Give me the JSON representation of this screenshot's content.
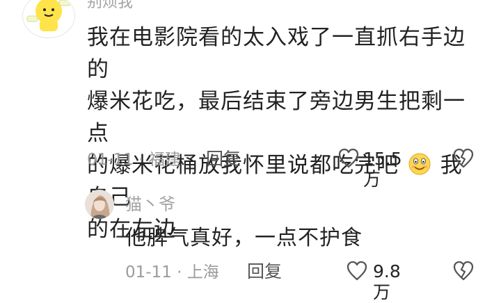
{
  "comment": {
    "username": "别烦我",
    "text_line1": "我在电影院看的太入戏了一直抓右手边的",
    "text_line2": "爆米花吃，最后结束了旁边男生把剩一点",
    "text_line3_before_emoji": "的爆米花桶放我怀里说都吃完吧",
    "text_line3_after_emoji": "我自己",
    "text_line4": "的在左边",
    "date": "01-11",
    "dot": "·",
    "location": "福建",
    "reply_label": "回复",
    "like_count": "15.5万",
    "emoji_icon": "smiling-face-emoji"
  },
  "reply_comment": {
    "username": "猫丶爷",
    "text": "他脾气真好，一点不护食",
    "date": "01-11",
    "dot": "·",
    "location": "上海",
    "reply_label": "回复",
    "like_count": "9.8万"
  },
  "icons": {
    "like": "heart-outline-icon",
    "dislike": "broken-heart-icon"
  }
}
